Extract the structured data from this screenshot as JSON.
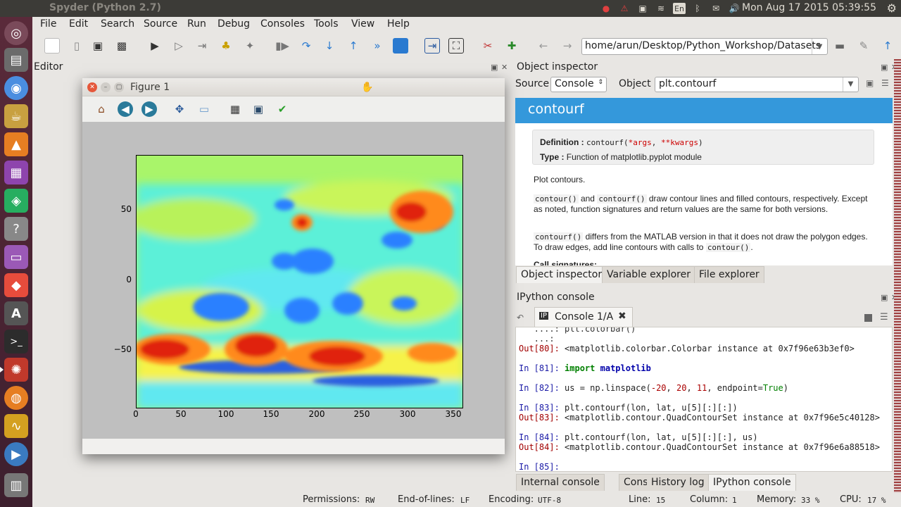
{
  "system": {
    "window_title": "Spyder (Python 2.7)",
    "clock": "Mon Aug 17 2015 05:39:55",
    "keyboard_layout": "En"
  },
  "menu": [
    "File",
    "Edit",
    "Search",
    "Source",
    "Run",
    "Debug",
    "Consoles",
    "Tools",
    "View",
    "Help"
  ],
  "toolbar": {
    "path": "home/arun/Desktop/Python_Workshop/Datasets"
  },
  "editor": {
    "title": "Editor"
  },
  "figure": {
    "title": "Figure 1",
    "chart_data": {
      "type": "heatmap",
      "title": "",
      "xlabel": "",
      "ylabel": "",
      "x_ticks": [
        "0",
        "50",
        "100",
        "150",
        "200",
        "250",
        "300",
        "350"
      ],
      "y_ticks": [
        "50",
        "0",
        "−50"
      ],
      "xlim": [
        0,
        360
      ],
      "ylim": [
        -90,
        90
      ],
      "colormap": "jet"
    }
  },
  "object_inspector": {
    "title": "Object inspector",
    "source_label": "Source",
    "source_value": "Console",
    "object_label": "Object",
    "object_value": "plt.contourf",
    "heading": "contourf",
    "definition_label": "Definition :",
    "definition_name": "contourf(",
    "definition_args": "*args",
    "definition_sep": ", ",
    "definition_kwargs": "**kwargs",
    "definition_end": ")",
    "type_label": "Type :",
    "type_value": "Function of matplotlib.pyplot module",
    "para1": "Plot contours.",
    "para2_code1": "contour()",
    "para2_mid": " and ",
    "para2_code2": "contourf()",
    "para2_rest": " draw contour lines and filled contours, respectively. Except as noted, function signatures and return values are the same for both versions.",
    "para3_code": "contourf()",
    "para3_rest": " differs from the MATLAB version in that it does not draw the polygon edges. To draw edges, add line contours with calls to ",
    "para3_code2": "contour()",
    "para3_end": ".",
    "para4": "Call signatures:"
  },
  "top_tabs": [
    "Object inspector",
    "Variable explorer",
    "File explorer"
  ],
  "ipython": {
    "title": "IPython console",
    "tab_label": "Console 1/A",
    "lines": {
      "l0": "   ....: plt.colorbar()",
      "l1": "   ...:",
      "l2_prompt": "Out[80]: ",
      "l2_text": "<matplotlib.colorbar.Colorbar instance at 0x7f96e63b3ef0>",
      "l3_prompt": "In [81]: ",
      "l3_kw": "import",
      "l3_mod": " matplotlib",
      "l4_prompt": "In [82]: ",
      "l4_a": "us = np.linspace(",
      "l4_n1": "-20",
      "l4_b": ", ",
      "l4_n2": "20",
      "l4_c": ", ",
      "l4_n3": "11",
      "l4_d": ", endpoint=",
      "l4_kw": "True",
      "l4_e": ")",
      "l5_prompt": "In [83]: ",
      "l5_text": "plt.contourf(lon, lat, u[5][:][:])",
      "l6_prompt": "Out[83]: ",
      "l6_text": "<matplotlib.contour.QuadContourSet instance at 0x7f96e5c40128>",
      "l7_prompt": "In [84]: ",
      "l7_text": "plt.contourf(lon, lat, u[5][:][:], us)",
      "l8_prompt": "Out[84]: ",
      "l8_text": "<matplotlib.contour.QuadContourSet instance at 0x7f96e6a88518>",
      "l9_prompt": "In [85]: "
    }
  },
  "bottom_tabs": [
    "Internal console",
    "Console",
    "History log",
    "IPython console"
  ],
  "status": {
    "permissions_label": "Permissions:",
    "permissions_value": "RW",
    "eol_label": "End-of-lines:",
    "eol_value": "LF",
    "encoding_label": "Encoding:",
    "encoding_value": "UTF-8",
    "line_label": "Line:",
    "line_value": "15",
    "column_label": "Column:",
    "column_value": "1",
    "memory_label": "Memory:",
    "memory_value": "33 %",
    "cpu_label": "CPU:",
    "cpu_value": "17 %"
  },
  "colors": {
    "accent": "#3498db",
    "system_bar": "#3c3b37",
    "launcher": "#5a2a3a"
  }
}
